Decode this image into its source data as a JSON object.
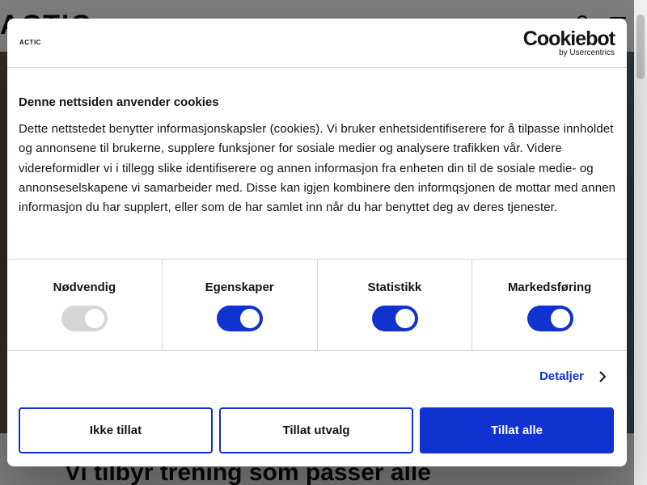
{
  "background": {
    "logo": "ACTIC",
    "headline": "Vi tilbyr trening som passer alle"
  },
  "dialog": {
    "brand_logo": "ACTIC",
    "cookiebot": {
      "wordmark": "Cookiebot",
      "sub": "by Usercentrics"
    },
    "title": "Denne nettsiden anvender cookies",
    "text": "Dette nettstedet benytter informasjonskapsler (cookies). Vi bruker enhetsidentifiserere for å tilpasse innholdet og annonsene til brukerne, supplere funksjoner for sosiale medier og analysere trafikken vår. Videre videreformidler vi i tillegg slike identifiserere og annen informasjon fra enheten din til de sosiale medie- og annonseselskapene vi samarbeider med. Disse kan igjen kombinere den informqsjonen de mottar med annen informasjon du har supplert, eller som de har samlet inn når du har benyttet deg av deres tjenester.",
    "toggles": [
      {
        "label": "Nødvendig",
        "state": "on",
        "disabled": true
      },
      {
        "label": "Egenskaper",
        "state": "on",
        "disabled": false
      },
      {
        "label": "Statistikk",
        "state": "on",
        "disabled": false
      },
      {
        "label": "Markedsføring",
        "state": "on",
        "disabled": false
      }
    ],
    "details_label": "Detaljer",
    "buttons": {
      "deny": "Ikke tillat",
      "allow_selection": "Tillat utvalg",
      "allow_all": "Tillat alle"
    }
  },
  "colors": {
    "accent": "#1032cf",
    "toggle_disabled": "#d6d6d6",
    "text": "#141414"
  }
}
